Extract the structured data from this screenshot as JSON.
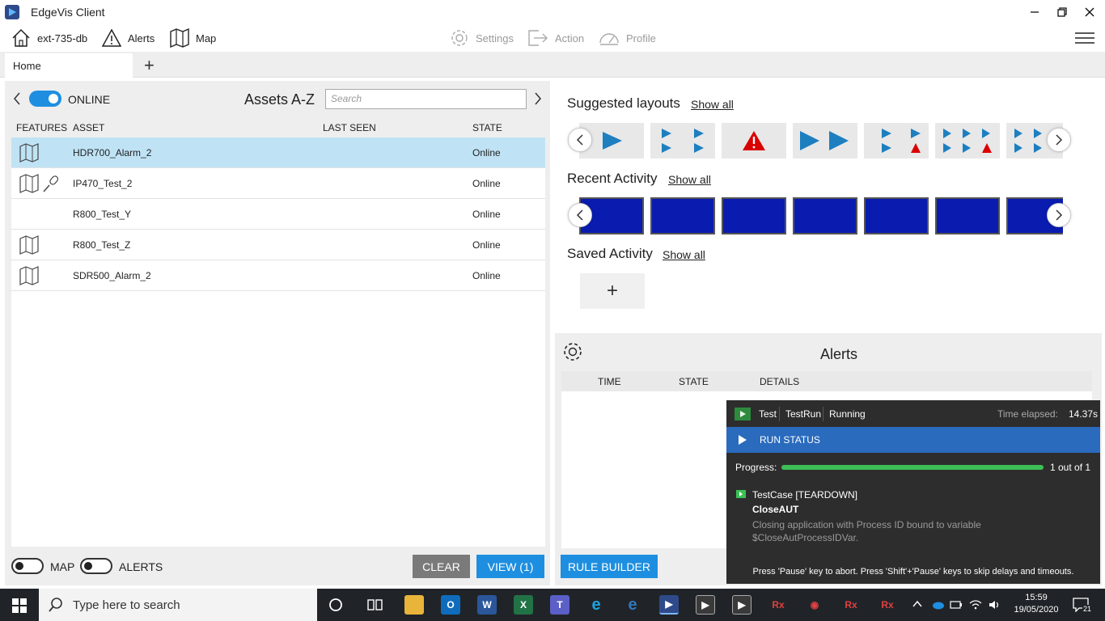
{
  "window": {
    "title": "EdgeVis Client"
  },
  "nav": {
    "server": "ext-735-db",
    "alerts": "Alerts",
    "map": "Map",
    "settings": "Settings",
    "action": "Action",
    "profile": "Profile"
  },
  "tabs": {
    "home": "Home",
    "add": "+"
  },
  "assets": {
    "online_label": "ONLINE",
    "title": "Assets A-Z",
    "search_placeholder": "Search",
    "columns": {
      "features": "FEATURES",
      "asset": "ASSET",
      "last_seen": "LAST SEEN",
      "state": "STATE"
    },
    "rows": [
      {
        "asset": "HDR700_Alarm_2",
        "last_seen": "",
        "state": "Online",
        "icons": [
          "map-icon"
        ],
        "selected": true
      },
      {
        "asset": "IP470_Test_2",
        "last_seen": "",
        "state": "Online",
        "icons": [
          "map-icon",
          "microphone-icon"
        ],
        "selected": false
      },
      {
        "asset": "R800_Test_Y",
        "last_seen": "",
        "state": "Online",
        "icons": [],
        "selected": false
      },
      {
        "asset": "R800_Test_Z",
        "last_seen": "",
        "state": "Online",
        "icons": [
          "map-icon"
        ],
        "selected": false
      },
      {
        "asset": "SDR500_Alarm_2",
        "last_seen": "",
        "state": "Online",
        "icons": [
          "map-icon"
        ],
        "selected": false
      }
    ],
    "map_toggle": "MAP",
    "alerts_toggle": "ALERTS",
    "clear_button": "CLEAR",
    "view_button": "VIEW (1)"
  },
  "layouts": {
    "suggested_title": "Suggested layouts",
    "recent_title": "Recent Activity",
    "saved_title": "Saved Activity",
    "show_all": "Show all",
    "add": "+"
  },
  "alerts": {
    "title": "Alerts",
    "columns": {
      "time": "TIME",
      "state": "STATE",
      "details": "DETAILS"
    },
    "rule_builder": "RULE BUILDER"
  },
  "run_panel": {
    "test": "Test",
    "testrun": "TestRun",
    "running": "Running",
    "elapsed_label": "Time elapsed:",
    "elapsed_value": "14.37s",
    "status_label": "RUN STATUS",
    "progress_label": "Progress:",
    "progress_fraction": 1.0,
    "progress_text": "1 out of 1",
    "testcase": "TestCase [TEARDOWN]",
    "step": "CloseAUT",
    "description": "Closing application with Process ID bound to variable $CloseAutProcessIDVar.",
    "footer": "Press 'Pause' key to abort. Press 'Shift'+'Pause' keys to skip delays and timeouts."
  },
  "taskbar": {
    "search_placeholder": "Type here to search",
    "time": "15:59",
    "date": "19/05/2020",
    "notifications": "21"
  },
  "colors": {
    "accent": "#1e8fe0",
    "selected_row": "#bfe3f5",
    "run_status": "#2a6bbd",
    "progress": "#3cbf55"
  }
}
